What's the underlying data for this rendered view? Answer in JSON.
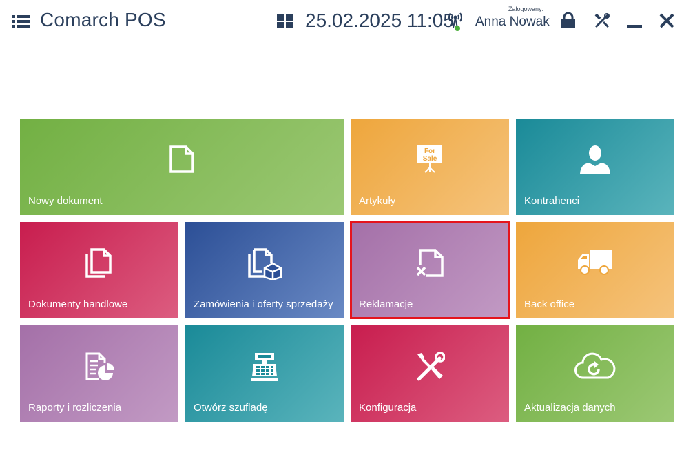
{
  "header": {
    "app_title": "Comarch POS",
    "datetime": "25.02.2025 11:05",
    "logged_label": "Zalogowany:",
    "user_name": "Anna Nowak"
  },
  "icons": {
    "menu": "hamburger-menu-icon",
    "apps": "grid-icon",
    "connection": "antenna-icon",
    "lock": "lock-icon",
    "settings": "tools-icon",
    "minimize": "minimize-icon",
    "close": "close-icon"
  },
  "tiles": [
    {
      "label": "Nowy dokument",
      "icon": "document-icon",
      "color": "green"
    },
    {
      "label": "Artykuły",
      "icon": "for-sale-sign-icon",
      "icon_text_1": "For",
      "icon_text_2": "Sale",
      "color": "orange"
    },
    {
      "label": "Kontrahenci",
      "icon": "person-icon",
      "color": "teal"
    },
    {
      "label": "Dokumenty handlowe",
      "icon": "documents-icon",
      "color": "red"
    },
    {
      "label": "Zamówienia i oferty sprzedaży",
      "icon": "documents-box-icon",
      "color": "blue"
    },
    {
      "label": "Reklamacje",
      "icon": "document-x-icon",
      "color": "purple",
      "selected": true
    },
    {
      "label": "Back office",
      "icon": "truck-icon",
      "color": "orange"
    },
    {
      "label": "Raporty i rozliczenia",
      "icon": "report-chart-icon",
      "color": "purple"
    },
    {
      "label": "Otwórz szufladę",
      "icon": "cash-register-icon",
      "color": "teal"
    },
    {
      "label": "Konfiguracja",
      "icon": "wrench-screwdriver-icon",
      "color": "red"
    },
    {
      "label": "Aktualizacja danych",
      "icon": "cloud-refresh-icon",
      "color": "green"
    }
  ],
  "colors": {
    "green": "#72b043",
    "orange": "#eea63c",
    "teal": "#1a8a98",
    "red": "#c81d4e",
    "blue": "#2c4f96",
    "purple": "#a470a8",
    "selection_border": "#e5141d",
    "header_text": "#2b3f5c"
  }
}
